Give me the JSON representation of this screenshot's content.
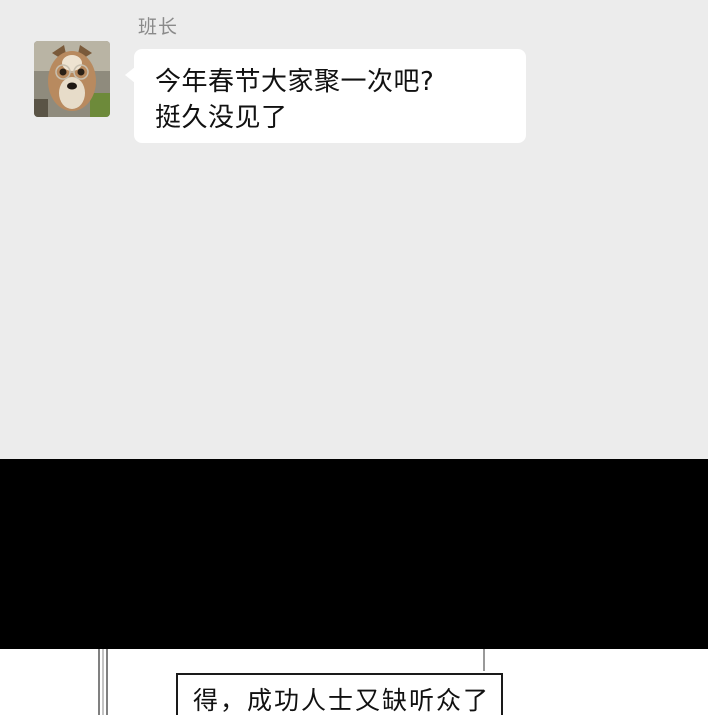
{
  "chat": {
    "sender_name": "班长",
    "message_line_1": "今年春节大家聚一次吧?",
    "message_line_2": "挺久没见了"
  },
  "comic": {
    "caption": "得，成功人士又缺听众了"
  }
}
